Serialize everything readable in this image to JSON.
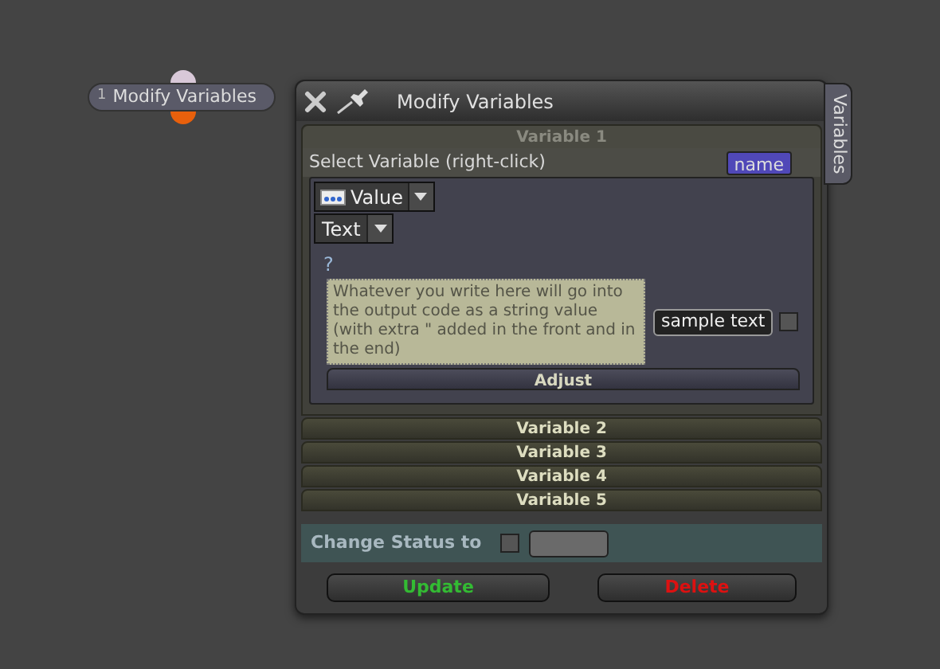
{
  "node": {
    "index": "1",
    "label": "Modify Variables"
  },
  "window": {
    "title": "Modify Variables",
    "side_tab": "Variables"
  },
  "variables": [
    {
      "title": "Variable 1",
      "expanded": true,
      "select_label": "Select Variable (right-click)",
      "name_button": "name",
      "value_type": "Value",
      "input_type": "Text",
      "help": "?",
      "description": "Whatever you write here will go into the output code as a string value (with extra \" added in the front and in the end)",
      "sample": "sample text",
      "sample_checked": false,
      "adjust": "Adjust"
    },
    {
      "title": "Variable 2",
      "expanded": false
    },
    {
      "title": "Variable 3",
      "expanded": false
    },
    {
      "title": "Variable 4",
      "expanded": false
    },
    {
      "title": "Variable 5",
      "expanded": false
    }
  ],
  "status": {
    "label": "Change Status to",
    "checked": false
  },
  "buttons": [
    {
      "label": "Update",
      "kind": "update"
    },
    {
      "label": "Delete",
      "kind": "delete"
    }
  ]
}
